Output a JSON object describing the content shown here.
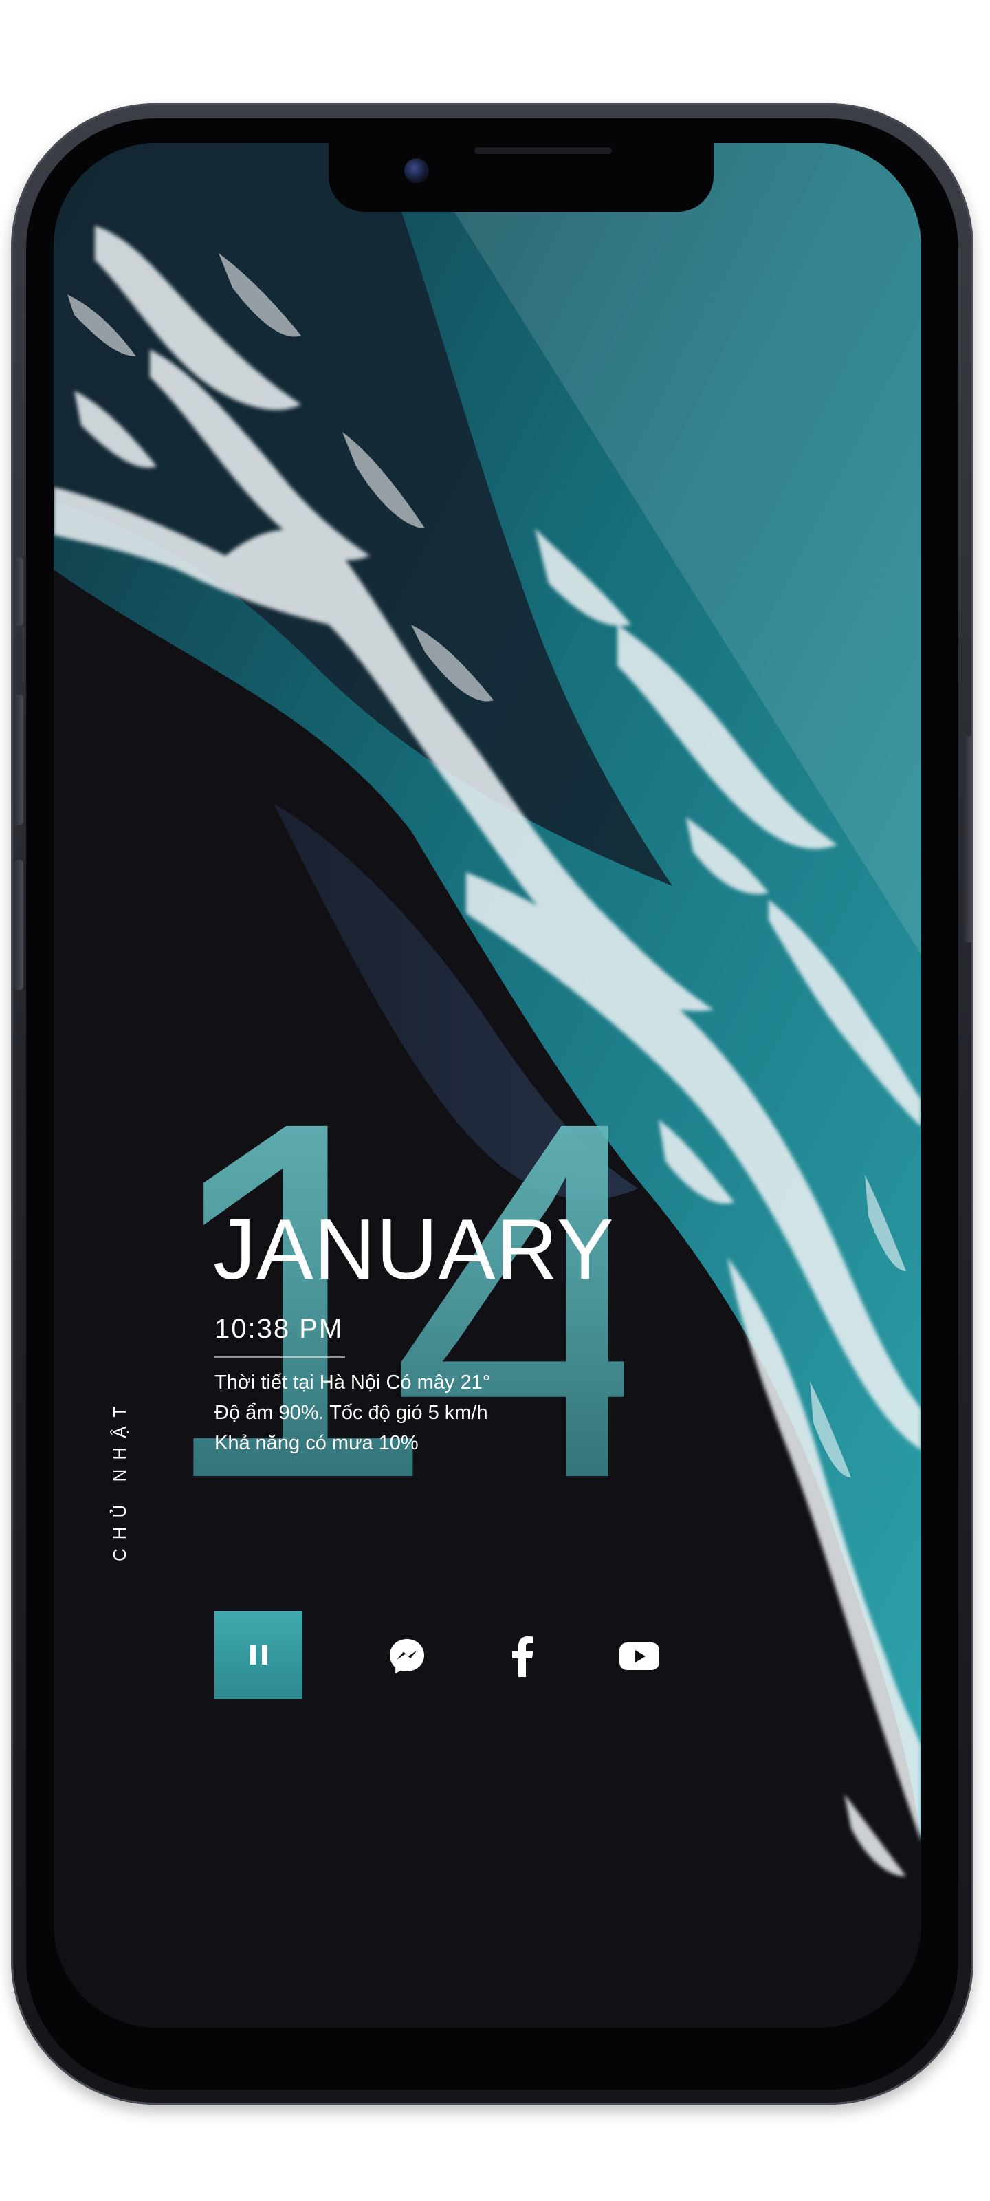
{
  "lock_screen": {
    "day_number": "14",
    "month": "JANUARY",
    "time": "10:38 PM",
    "weekday": "CHỦ NHẬT",
    "weather_lines": [
      "Thời tiết tại Hà Nội Có mây 21°",
      "Độ ẩm 90%. Tốc độ gió 5 km/h",
      "Khả năng có mưa 10%"
    ]
  },
  "controls": {
    "pause_icon": "pause-icon",
    "social_icons": [
      "messenger-icon",
      "facebook-icon",
      "youtube-icon"
    ]
  },
  "colors": {
    "accent_teal": "#3fa9ae",
    "day_number_teal": "#5fb6b9",
    "ocean_teal": "#1f8c96",
    "sand_black": "#111015",
    "text_white": "#ffffff"
  }
}
